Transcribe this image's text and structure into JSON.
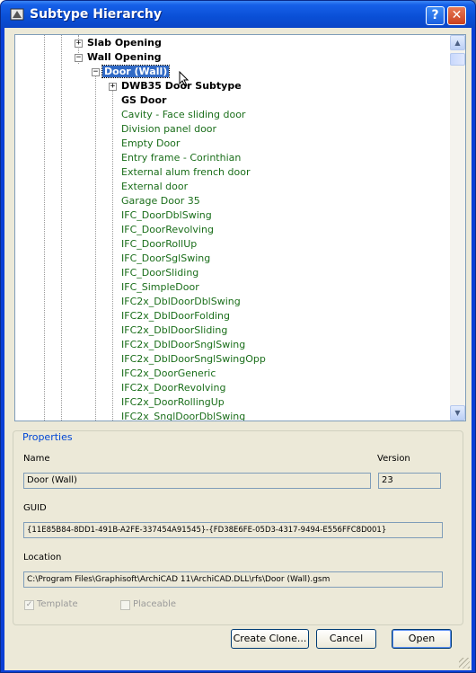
{
  "window": {
    "title": "Subtype Hierarchy",
    "help_label": "?",
    "close_label": "✕"
  },
  "tree": {
    "items": [
      {
        "label": "Slab Opening",
        "expander": "+"
      },
      {
        "label": "Wall Opening",
        "expander": "−"
      },
      {
        "label": "Door (Wall)",
        "expander": "−"
      },
      {
        "label": "DWB35 Door Subtype",
        "expander": "+"
      },
      {
        "label": "GS Door"
      },
      {
        "label": "Cavity - Face sliding door"
      },
      {
        "label": "Division panel door"
      },
      {
        "label": "Empty Door"
      },
      {
        "label": "Entry frame - Corinthian"
      },
      {
        "label": "External alum french door"
      },
      {
        "label": "External door"
      },
      {
        "label": "Garage Door 35"
      },
      {
        "label": "IFC_DoorDblSwing"
      },
      {
        "label": "IFC_DoorRevolving"
      },
      {
        "label": "IFC_DoorRollUp"
      },
      {
        "label": "IFC_DoorSglSwing"
      },
      {
        "label": "IFC_DoorSliding"
      },
      {
        "label": "IFC_SimpleDoor"
      },
      {
        "label": "IFC2x_DblDoorDblSwing"
      },
      {
        "label": "IFC2x_DblDoorFolding"
      },
      {
        "label": "IFC2x_DblDoorSliding"
      },
      {
        "label": "IFC2x_DblDoorSnglSwing"
      },
      {
        "label": "IFC2x_DblDoorSnglSwingOpp"
      },
      {
        "label": "IFC2x_DoorGeneric"
      },
      {
        "label": "IFC2x_DoorRevolving"
      },
      {
        "label": "IFC2x_DoorRollingUp"
      },
      {
        "label": "IFC2x_SnglDoorDblSwing"
      }
    ],
    "scroll_up": "▲",
    "scroll_down": "▼"
  },
  "properties": {
    "legend": "Properties",
    "name_label": "Name",
    "name_value": "Door (Wall)",
    "version_label": "Version",
    "version_value": "23",
    "guid_label": "GUID",
    "guid_value": "{11E85B84-8DD1-491B-A2FE-337454A91545}-{FD38E6FE-05D3-4317-9494-E556FFC8D001}",
    "location_label": "Location",
    "location_value": "C:\\Program Files\\Graphisoft\\ArchiCAD 11\\ArchiCAD.DLL\\rfs\\Door (Wall).gsm",
    "template_label": "Template",
    "template_mark": "✓",
    "placeable_label": "Placeable"
  },
  "buttons": {
    "create_clone": "Create Clone...",
    "cancel": "Cancel",
    "open": "Open"
  },
  "colors": {
    "selection": "#316ac5",
    "subtype_text": "#1a6e1a",
    "title_bar": "#0a4fd6",
    "dialog_bg": "#ece9d8"
  }
}
